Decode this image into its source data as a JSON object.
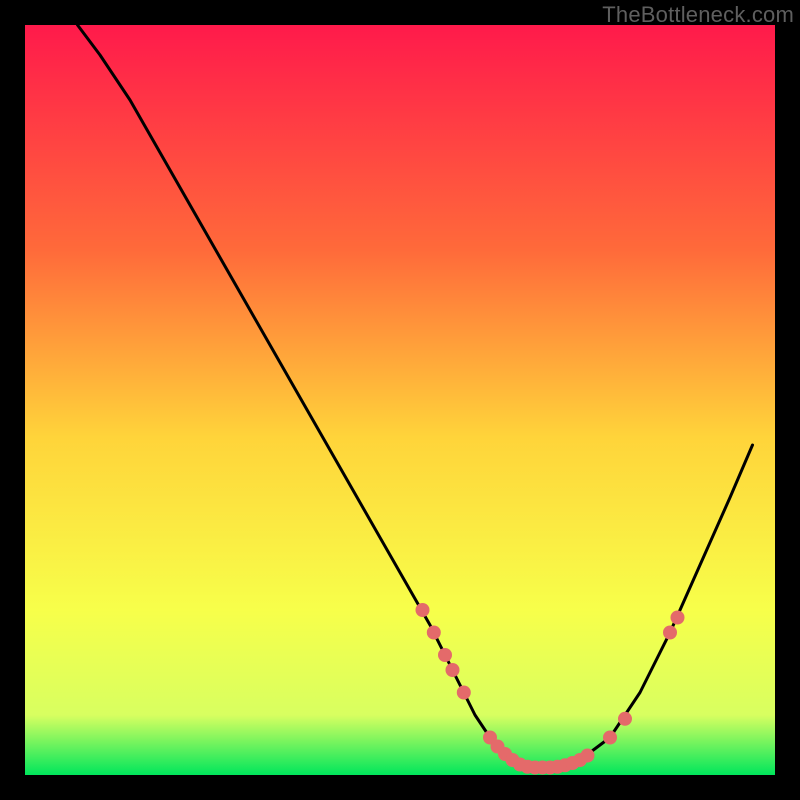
{
  "watermark": "TheBottleneck.com",
  "colors": {
    "gradient_top": "#ff1a4b",
    "gradient_mid1": "#ff6a3a",
    "gradient_mid2": "#ffd43a",
    "gradient_mid3": "#f7ff4a",
    "gradient_mid4": "#d8ff60",
    "gradient_bottom": "#00e65c",
    "curve": "#000000",
    "marker": "#e46a6a",
    "axis": "#000000"
  },
  "chart_data": {
    "type": "line",
    "title": "",
    "xlabel": "",
    "ylabel": "",
    "xlim": [
      0,
      100
    ],
    "ylim": [
      0,
      100
    ],
    "curve": {
      "name": "bottleneck-curve",
      "x": [
        7,
        10,
        14,
        18,
        22,
        26,
        30,
        34,
        38,
        42,
        46,
        50,
        54,
        58,
        60,
        62,
        64,
        66,
        68,
        70,
        72,
        74,
        78,
        82,
        86,
        90,
        94,
        97
      ],
      "y": [
        100,
        96,
        90,
        83,
        76,
        69,
        62,
        55,
        48,
        41,
        34,
        27,
        20,
        12,
        8,
        5,
        3,
        1.5,
        1,
        1,
        1.3,
        2,
        5,
        11,
        19,
        28,
        37,
        44
      ]
    },
    "markers": {
      "name": "highlighted-points",
      "points": [
        {
          "x": 53,
          "y": 22
        },
        {
          "x": 54.5,
          "y": 19
        },
        {
          "x": 56,
          "y": 16
        },
        {
          "x": 57,
          "y": 14
        },
        {
          "x": 58.5,
          "y": 11
        },
        {
          "x": 62,
          "y": 5
        },
        {
          "x": 63,
          "y": 3.8
        },
        {
          "x": 64,
          "y": 2.8
        },
        {
          "x": 65,
          "y": 2
        },
        {
          "x": 66,
          "y": 1.4
        },
        {
          "x": 67,
          "y": 1.1
        },
        {
          "x": 68,
          "y": 1
        },
        {
          "x": 69,
          "y": 1
        },
        {
          "x": 70,
          "y": 1
        },
        {
          "x": 71,
          "y": 1.1
        },
        {
          "x": 72,
          "y": 1.3
        },
        {
          "x": 73,
          "y": 1.6
        },
        {
          "x": 74,
          "y": 2
        },
        {
          "x": 75,
          "y": 2.6
        },
        {
          "x": 78,
          "y": 5
        },
        {
          "x": 80,
          "y": 7.5
        },
        {
          "x": 86,
          "y": 19
        },
        {
          "x": 87,
          "y": 21
        }
      ]
    }
  }
}
